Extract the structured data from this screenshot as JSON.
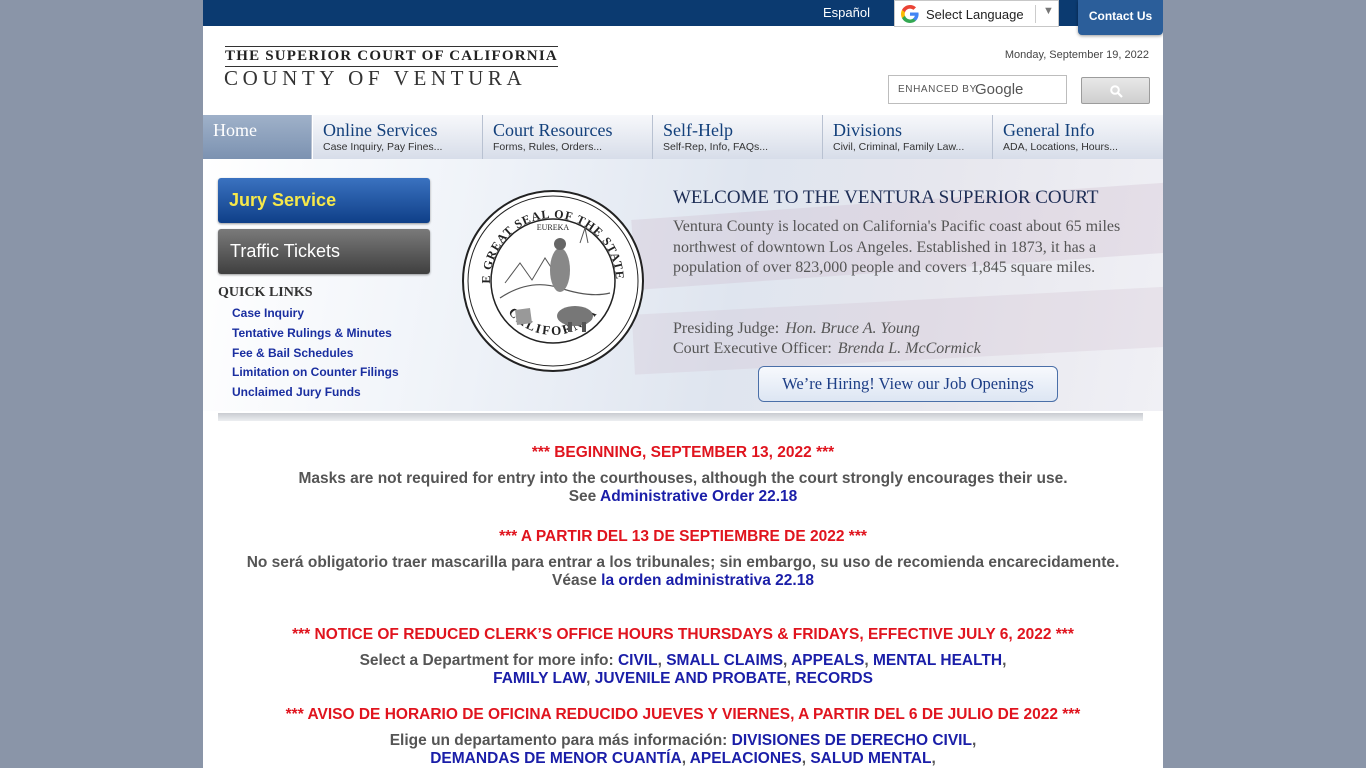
{
  "topbar": {
    "espanol": "Español",
    "translate_label": "Select Language",
    "translate_arrow": "▼",
    "contact": "Contact Us"
  },
  "header": {
    "logo_line1": "THE SUPERIOR COURT OF CALIFORNIA",
    "logo_line2": "COUNTY OF VENTURA",
    "date": "Monday, September 19, 2022",
    "search_enhanced": "ENHANCED BY",
    "search_google": "Google"
  },
  "nav": [
    {
      "title": "Home",
      "sub": ""
    },
    {
      "title": "Online Services",
      "sub": "Case Inquiry, Pay Fines..."
    },
    {
      "title": "Court Resources",
      "sub": "Forms, Rules, Orders..."
    },
    {
      "title": "Self-Help",
      "sub": "Self-Rep, Info, FAQs..."
    },
    {
      "title": "Divisions",
      "sub": "Civil, Criminal, Family Law..."
    },
    {
      "title": "General Info",
      "sub": "ADA, Locations, Hours..."
    }
  ],
  "hero": {
    "jury": "Jury Service",
    "traffic": "Traffic Tickets",
    "quick_links_title": "QUICK LINKS",
    "quick_links": [
      "Case Inquiry",
      "Tentative Rulings & Minutes",
      "Fee & Bail Schedules",
      "Limitation on Counter Filings",
      "Unclaimed Jury Funds"
    ],
    "seal_top": "THE GREAT SEAL OF THE STATE OF",
    "seal_bottom": "CALIFORNIA",
    "seal_motto": "EUREKA",
    "welcome": "WELCOME TO THE VENTURA SUPERIOR COURT",
    "intro": "Ventura County is located on California's Pacific coast about 65 miles northwest of downtown Los Angeles.  Established in 1873, it has a population of over 823,000 people and covers 1,845 square miles.",
    "judge_label": "Presiding Judge:",
    "judge_name": "Hon. Bruce A. Young",
    "ceo_label": "Court Executive Officer:",
    "ceo_name": "Brenda L. McCormick",
    "hiring": "We’re Hiring! View our Job Openings"
  },
  "notices": {
    "n1_head": "*** BEGINNING, SEPTEMBER 13, 2022 ***",
    "n1_body": "Masks are not required for entry into the courthouses, although the court strongly encourages their use.",
    "n1_see": "See",
    "n1_link": "Administrative Order 22.18",
    "n2_head": "*** A PARTIR DEL 13 DE SEPTIEMBRE DE 2022 ***",
    "n2_body": "No será obligatorio traer mascarilla para entrar a los tribunales; sin embargo, su uso de recomienda encarecidamente.",
    "n2_see": "Véase",
    "n2_link": "la orden administrativa 22.18",
    "n3_head": "*** NOTICE OF REDUCED CLERK’S OFFICE HOURS THURSDAYS & FRIDAYS, EFFECTIVE JULY 6, 2022 ***",
    "n3_prefix": "Select a Department for more info:",
    "n3_links": [
      "CIVIL",
      "SMALL CLAIMS",
      "APPEALS",
      "MENTAL HEALTH",
      "FAMILY LAW",
      "JUVENILE AND PROBATE",
      "RECORDS"
    ],
    "n4_head": "*** AVISO DE HORARIO DE OFICINA REDUCIDO JUEVES Y VIERNES, A PARTIR DEL 6 DE JULIO DE 2022 ***",
    "n4_prefix": "Elige un departamento para más información:",
    "n4_links": [
      "DIVISIONES DE DERECHO CIVIL",
      "DEMANDAS DE MENOR CUANTÍA",
      "APELACIONES",
      "SALUD MENTAL"
    ]
  },
  "colors": {
    "topbar": "#0b3a70",
    "notice_red": "#e0141e",
    "link_blue": "#1a1ea8",
    "jury_text": "#f6e84a"
  }
}
